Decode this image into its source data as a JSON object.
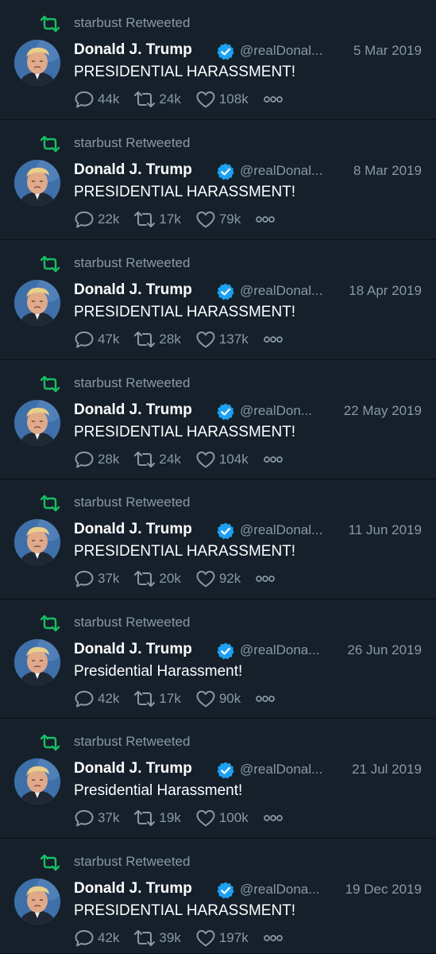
{
  "colors": {
    "background": "#15202b",
    "separator": "#0a0f14",
    "retweet_icon": "#17bf63",
    "muted_text": "#8899a6",
    "primary_text": "#ffffff",
    "verified": "#1da1f2"
  },
  "tweets": [
    {
      "retweeted_by": "starbust Retweeted",
      "name": "Donald J. Trump",
      "handle": "@realDonal...",
      "date": "5 Mar 2019",
      "text": "PRESIDENTIAL HARASSMENT!",
      "replies": "44k",
      "retweets": "24k",
      "likes": "108k"
    },
    {
      "retweeted_by": "starbust Retweeted",
      "name": "Donald J. Trump",
      "handle": "@realDonal...",
      "date": "8 Mar 2019",
      "text": "PRESIDENTIAL HARASSMENT!",
      "replies": "22k",
      "retweets": "17k",
      "likes": "79k"
    },
    {
      "retweeted_by": "starbust Retweeted",
      "name": "Donald J. Trump",
      "handle": "@realDonal...",
      "date": "18 Apr 2019",
      "text": "PRESIDENTIAL HARASSMENT!",
      "replies": "47k",
      "retweets": "28k",
      "likes": "137k"
    },
    {
      "retweeted_by": "starbust Retweeted",
      "name": "Donald J. Trump",
      "handle": "@realDon...",
      "date": "22 May 2019",
      "text": "PRESIDENTIAL HARASSMENT!",
      "replies": "28k",
      "retweets": "24k",
      "likes": "104k"
    },
    {
      "retweeted_by": "starbust Retweeted",
      "name": "Donald J. Trump",
      "handle": "@realDonal...",
      "date": "11 Jun 2019",
      "text": "PRESIDENTIAL HARASSMENT!",
      "replies": "37k",
      "retweets": "20k",
      "likes": "92k"
    },
    {
      "retweeted_by": "starbust Retweeted",
      "name": "Donald J. Trump",
      "handle": "@realDona...",
      "date": "26 Jun 2019",
      "text": "Presidential Harassment!",
      "replies": "42k",
      "retweets": "17k",
      "likes": "90k"
    },
    {
      "retweeted_by": "starbust Retweeted",
      "name": "Donald J. Trump",
      "handle": "@realDonal...",
      "date": "21 Jul 2019",
      "text": "Presidential Harassment!",
      "replies": "37k",
      "retweets": "19k",
      "likes": "100k"
    },
    {
      "retweeted_by": "starbust Retweeted",
      "name": "Donald J. Trump",
      "handle": "@realDona...",
      "date": "19 Dec 2019",
      "text": "PRESIDENTIAL HARASSMENT!",
      "replies": "42k",
      "retweets": "39k",
      "likes": "197k"
    }
  ],
  "icons": {
    "retweet_context": "retweet-icon",
    "verified": "verified-badge-icon",
    "reply": "reply-icon",
    "retweet": "retweet-icon",
    "like": "like-icon",
    "more": "more-icon"
  }
}
